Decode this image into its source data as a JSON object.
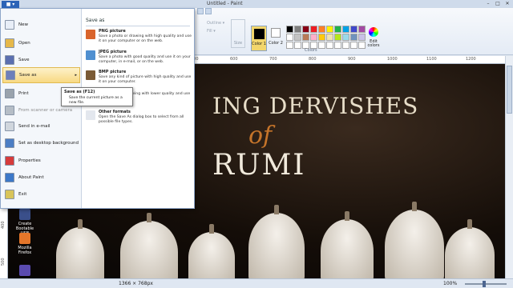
{
  "window": {
    "title": "Untitled - Paint",
    "file_tab": "■ ▾",
    "minimize": "–",
    "maximize": "□",
    "close": "✕"
  },
  "ribbon": {
    "outline": "Outline ▾",
    "fill": "Fill ▾",
    "size": "Size",
    "color1": "Color 1",
    "color2": "Color 2",
    "edit_colors": "Edit colors",
    "colors_group": "Colors",
    "palette": [
      "#000000",
      "#7f7f7f",
      "#880015",
      "#ed1c24",
      "#ff7f27",
      "#fff200",
      "#22b14c",
      "#00a2e8",
      "#3f48cc",
      "#a349a4",
      "#ffffff",
      "#c3c3c3",
      "#b97a57",
      "#ffaec9",
      "#ffc90e",
      "#efe4b0",
      "#b5e61d",
      "#99d9ea",
      "#7092be",
      "#c8bfe7",
      "#ffffff",
      "#ffffff",
      "#ffffff",
      "#ffffff",
      "#ffffff",
      "#ffffff",
      "#ffffff",
      "#ffffff",
      "#ffffff",
      "#ffffff"
    ]
  },
  "ruler": {
    "h_ticks": [
      "100",
      "200",
      "300",
      "400",
      "500",
      "600",
      "700",
      "800",
      "900",
      "1000",
      "1100",
      "1200"
    ],
    "v_ticks": [
      "400",
      "500"
    ]
  },
  "file_menu": {
    "items": [
      {
        "label": "New",
        "icon": "new-file-icon",
        "color": "#e8eef7"
      },
      {
        "label": "Open",
        "icon": "open-folder-icon",
        "color": "#e6b84a"
      },
      {
        "label": "Save",
        "icon": "save-disk-icon",
        "color": "#5b6fb0"
      },
      {
        "label": "Save as",
        "icon": "save-as-icon",
        "color": "#6d7fba"
      },
      {
        "label": "Print",
        "icon": "printer-icon",
        "color": "#9aa3ad"
      },
      {
        "label": "From scanner or camera",
        "icon": "scanner-icon",
        "color": "#b5bdc6"
      },
      {
        "label": "Send in e-mail",
        "icon": "email-icon",
        "color": "#d0d6dd"
      },
      {
        "label": "Set as desktop background",
        "icon": "desktop-icon",
        "color": "#4c7ec4"
      },
      {
        "label": "Properties",
        "icon": "properties-check-icon",
        "color": "#d63b3b"
      },
      {
        "label": "About Paint",
        "icon": "info-icon",
        "color": "#3c78c8"
      },
      {
        "label": "Exit",
        "icon": "exit-icon",
        "color": "#d8c45a"
      }
    ],
    "save_as_header": "Save as",
    "save_as_options": [
      {
        "title": "PNG picture",
        "desc": "Save a photo or drawing with high quality and use it on your computer or on the web.",
        "icon": "png-icon",
        "color": "#d9642c"
      },
      {
        "title": "JPEG picture",
        "desc": "Save a photo with good quality and use it on your computer, in e-mail, or on the web.",
        "icon": "jpeg-icon",
        "color": "#4f8fd0"
      },
      {
        "title": "BMP picture",
        "desc": "Save any kind of picture with high quality and use it on your computer.",
        "icon": "bmp-icon",
        "color": "#7a5a35"
      },
      {
        "title": "",
        "desc": "Save a simple drawing with lower quality and use it on the web.",
        "icon": "gif-icon",
        "color": "#ffffff"
      },
      {
        "title": "Other formats",
        "desc": "Open the Save As dialog box to select from all possible file types.",
        "icon": "other-formats-icon",
        "color": "#e3e7ee"
      }
    ]
  },
  "tooltip": {
    "title": "Save as (F12)",
    "desc": "Save the current picture as a new file."
  },
  "canvas": {
    "line1": "ING DERVISHES",
    "line2": "of",
    "line3": "RUMI"
  },
  "desktop": [
    {
      "label": "Create Bootable USB",
      "color": "#3a4f8a"
    },
    {
      "label": "Mozilla Firefox",
      "color": "#e4762a"
    },
    {
      "label": "",
      "color": "#5a4bb0"
    }
  ],
  "status": {
    "dimensions": "1366 × 768px",
    "zoom": "100%",
    "zoom_fraction": 0.5
  }
}
